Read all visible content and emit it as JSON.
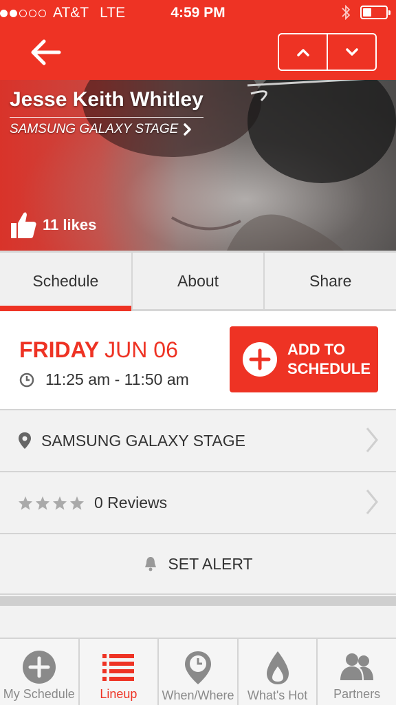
{
  "status_bar": {
    "carrier": "AT&T",
    "network": "LTE",
    "time": "4:59 PM",
    "signal_bars_filled": 2,
    "signal_bars_total": 5,
    "battery_level": 0.35,
    "bluetooth_icon": "bluetooth-icon"
  },
  "nav": {
    "back_icon": "arrow-left-icon",
    "prev_icon": "chevron-up-icon",
    "next_icon": "chevron-down-icon"
  },
  "hero": {
    "artist_name": "Jesse Keith Whitley",
    "stage_link": "SAMSUNG GALAXY STAGE",
    "likes_text": "11 likes"
  },
  "tabs": [
    {
      "label": "Schedule",
      "active": true
    },
    {
      "label": "About",
      "active": false
    },
    {
      "label": "Share",
      "active": false
    }
  ],
  "schedule": {
    "day": "FRIDAY",
    "date": "JUN 06",
    "time_range": "11:25 am - 11:50 am",
    "add_button_line1": "ADD TO",
    "add_button_line2": "SCHEDULE"
  },
  "details": {
    "location": "SAMSUNG GALAXY STAGE",
    "reviews": "0 Reviews",
    "rating_stars_filled": 0,
    "rating_stars_total": 4,
    "set_alert": "SET ALERT"
  },
  "tabbar": [
    {
      "label": "My Schedule",
      "icon": "plus-circle-icon",
      "active": false
    },
    {
      "label": "Lineup",
      "icon": "list-icon",
      "active": true
    },
    {
      "label": "When/Where",
      "icon": "map-pin-clock-icon",
      "active": false
    },
    {
      "label": "What's Hot",
      "icon": "flame-icon",
      "active": false
    },
    {
      "label": "Partners",
      "icon": "people-icon",
      "active": false
    }
  ],
  "colors": {
    "brand_red": "#ee3324",
    "text_dark": "#333333",
    "tab_inactive": "#8a8a8a"
  }
}
